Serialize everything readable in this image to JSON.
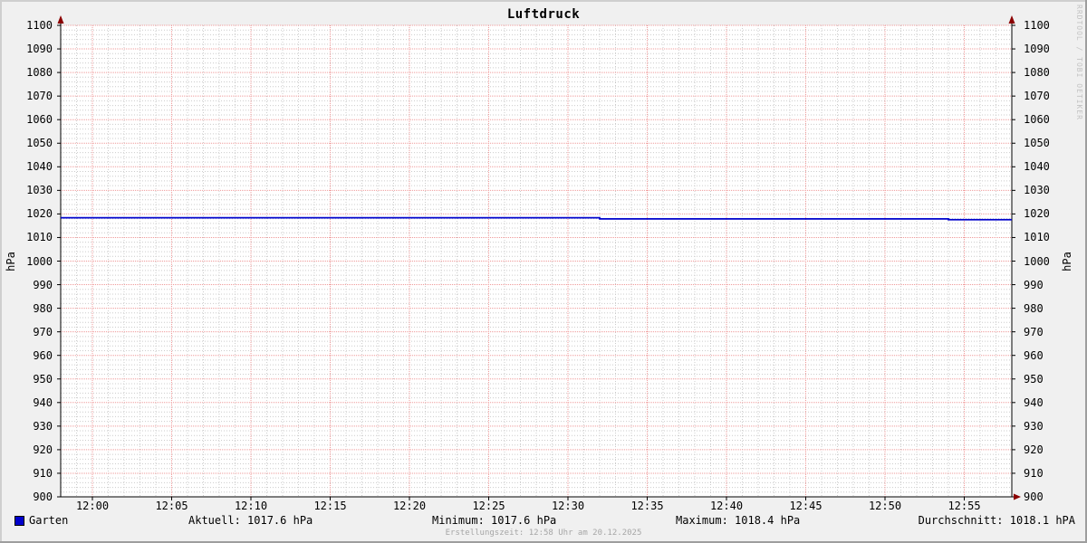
{
  "watermark": "RRDTOOL / TOBI OETIKER",
  "footer": "Erstellungszeit: 12:58 Uhr am 20.12.2025",
  "legend": {
    "series_label": "Garten",
    "stats": [
      "Aktuell: 1017.6 hPa",
      "Minimum: 1017.6 hPa",
      "Maximum: 1018.4 hPa",
      "Durchschnitt: 1018.1 hPA"
    ]
  },
  "chart_data": {
    "type": "line",
    "title": "Luftdruck",
    "ylabel": "hPa",
    "ylabel_right": "hPa",
    "ylim": [
      900,
      1100
    ],
    "ytick_step": 10,
    "yminor_step": 2,
    "x_range": [
      "11:58",
      "12:58"
    ],
    "x_ticks": [
      "12:00",
      "12:05",
      "12:10",
      "12:15",
      "12:20",
      "12:25",
      "12:30",
      "12:35",
      "12:40",
      "12:45",
      "12:50",
      "12:55"
    ],
    "xminor_step_minutes": 1,
    "grid": true,
    "legend_position": "bottom",
    "series": [
      {
        "name": "Garten",
        "color": "#0000cc",
        "points": [
          [
            "11:58",
            1018.4
          ],
          [
            "12:32",
            1018.4
          ],
          [
            "12:32",
            1017.9
          ],
          [
            "12:54",
            1017.9
          ],
          [
            "12:54",
            1017.6
          ],
          [
            "12:58",
            1017.6
          ]
        ]
      }
    ],
    "stats": {
      "aktuell_hpa": 1017.6,
      "minimum_hpa": 1017.6,
      "maximum_hpa": 1018.4,
      "durchschnitt_hpa": 1018.1
    },
    "colors": {
      "background": "#f0f0f0",
      "canvas": "#ffffff",
      "grid_major": "#ef9a9a",
      "grid_minor": "#cccccc",
      "axis": "#000000",
      "arrow": "#8b0000",
      "line": "#0000cc"
    }
  }
}
